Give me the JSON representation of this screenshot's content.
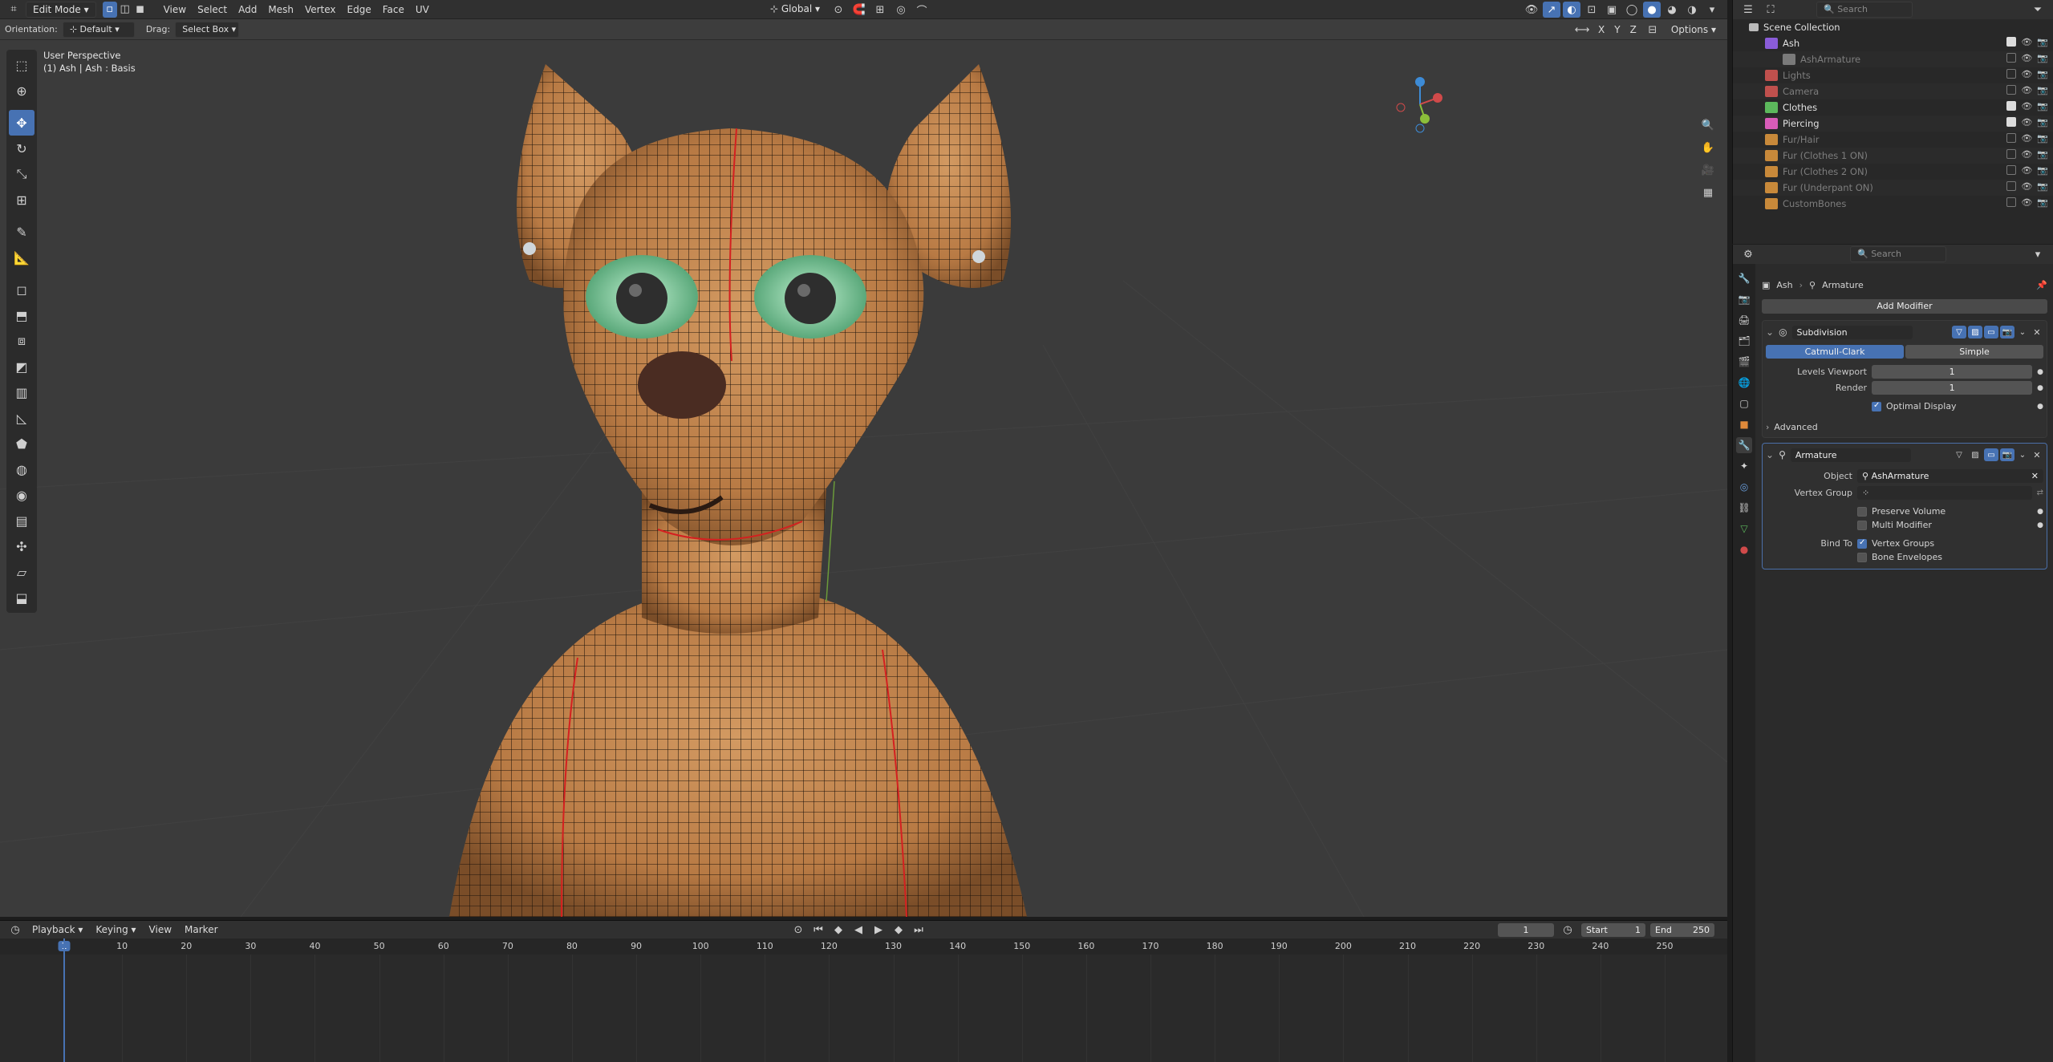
{
  "header": {
    "mode": "Edit Mode",
    "menus": [
      "View",
      "Select",
      "Add",
      "Mesh",
      "Vertex",
      "Edge",
      "Face",
      "UV"
    ],
    "transform_orientation": "Global",
    "search_placeholder": "Search",
    "options": "Options",
    "axes": [
      "X",
      "Y",
      "Z"
    ]
  },
  "tool_settings": {
    "orientation_label": "Orientation:",
    "orientation_value": "Default",
    "drag_label": "Drag:",
    "drag_value": "Select Box"
  },
  "viewport": {
    "perspective": "User Perspective",
    "object_info": "(1) Ash | Ash : Basis"
  },
  "outliner": {
    "search_placeholder": "Search",
    "root": "Scene Collection",
    "items": [
      {
        "label": "Ash",
        "color": "#8a5cd8",
        "dim": false
      },
      {
        "label": "AshArmature",
        "color": "#7a7a7a",
        "dim": true
      },
      {
        "label": "Lights",
        "color": "#c0504d",
        "dim": true
      },
      {
        "label": "Camera",
        "color": "#c0504d",
        "dim": true
      },
      {
        "label": "Clothes",
        "color": "#5cb85c",
        "dim": false
      },
      {
        "label": "Piercing",
        "color": "#d85cb8",
        "dim": false
      },
      {
        "label": "Fur/Hair",
        "color": "#c8893a",
        "dim": true
      },
      {
        "label": "Fur (Clothes 1 ON)",
        "color": "#c8893a",
        "dim": true
      },
      {
        "label": "Fur (Clothes 2 ON)",
        "color": "#c8893a",
        "dim": true
      },
      {
        "label": "Fur (Underpant ON)",
        "color": "#c8893a",
        "dim": true
      },
      {
        "label": "CustomBones",
        "color": "#c8893a",
        "dim": true
      }
    ]
  },
  "properties": {
    "search_placeholder": "Search",
    "breadcrumb": [
      "Ash",
      "Armature"
    ],
    "add_modifier": "Add Modifier",
    "subdivision": {
      "name": "Subdivision",
      "tabs": [
        "Catmull-Clark",
        "Simple"
      ],
      "levels_viewport_label": "Levels Viewport",
      "levels_viewport": "1",
      "render_label": "Render",
      "render": "1",
      "optimal_display": "Optimal Display",
      "advanced": "Advanced"
    },
    "armature": {
      "name": "Armature",
      "object_label": "Object",
      "object_value": "AshArmature",
      "vertex_group_label": "Vertex Group",
      "preserve_volume": "Preserve Volume",
      "multi_modifier": "Multi Modifier",
      "bind_to_label": "Bind To",
      "vertex_groups": "Vertex Groups",
      "bone_envelopes": "Bone Envelopes"
    }
  },
  "timeline": {
    "menus": [
      "Playback",
      "Keying",
      "View",
      "Marker"
    ],
    "current_frame": "1",
    "start_label": "Start",
    "start": "1",
    "end_label": "End",
    "end": "250",
    "ticks": [
      "1",
      "10",
      "20",
      "30",
      "40",
      "50",
      "60",
      "70",
      "80",
      "90",
      "100",
      "110",
      "120",
      "130",
      "140",
      "150",
      "160",
      "170",
      "180",
      "190",
      "200",
      "210",
      "220",
      "230",
      "240",
      "250"
    ]
  },
  "colors": {
    "accent": "#4772b3",
    "skin": "#c8874f",
    "eye": "#5fbf8a"
  }
}
